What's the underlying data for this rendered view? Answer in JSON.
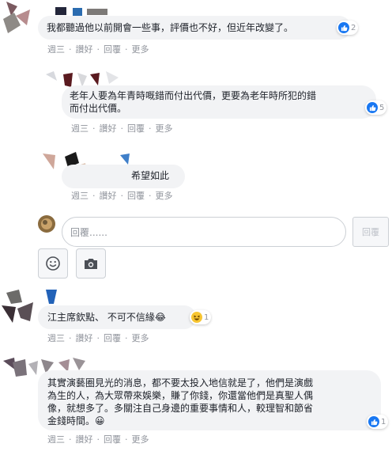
{
  "actions": {
    "time": "週三",
    "like": "讚好",
    "reply": "回覆",
    "more": "更多",
    "sep": "·"
  },
  "comments": [
    {
      "text": "我都聽過他以前開會一些事，評價也不好，但近年改變了。",
      "reactions": {
        "like_count": "2"
      }
    },
    {
      "text": "老年人要為年青時嘅錯而付出代價，更要為老年時所犯的錯\n而付出代價。",
      "reactions": {
        "like_count": "5"
      }
    },
    {
      "text": "希望如此"
    },
    {
      "text": "江主席欽點、 不可不信緣😂",
      "reactions": {
        "count": "1"
      }
    },
    {
      "text": "其實演藝圈見光的消息，都不要太投入地信就是了，他們是演戲\n為生的人，為大眾帶來娛樂，賺了你錢，你還當他們是真聖人偶\n像，就想多了。多關注自己身邊的重要事情和人，較理智和節省\n金錢時間。😀",
      "reactions": {
        "like_count": "1"
      }
    }
  ],
  "composer": {
    "placeholder": "回覆......",
    "submit_label": "回覆"
  },
  "icons": {
    "like": "thumbs-up-icon",
    "haha": "laughing-emoji-icon",
    "emoji": "smiley-icon",
    "camera": "camera-icon"
  },
  "colors": {
    "bubble": "#f2f3f5",
    "meta_text": "#90949c",
    "like_blue": "#1877f2",
    "haha_yellow": "#f7c531"
  }
}
